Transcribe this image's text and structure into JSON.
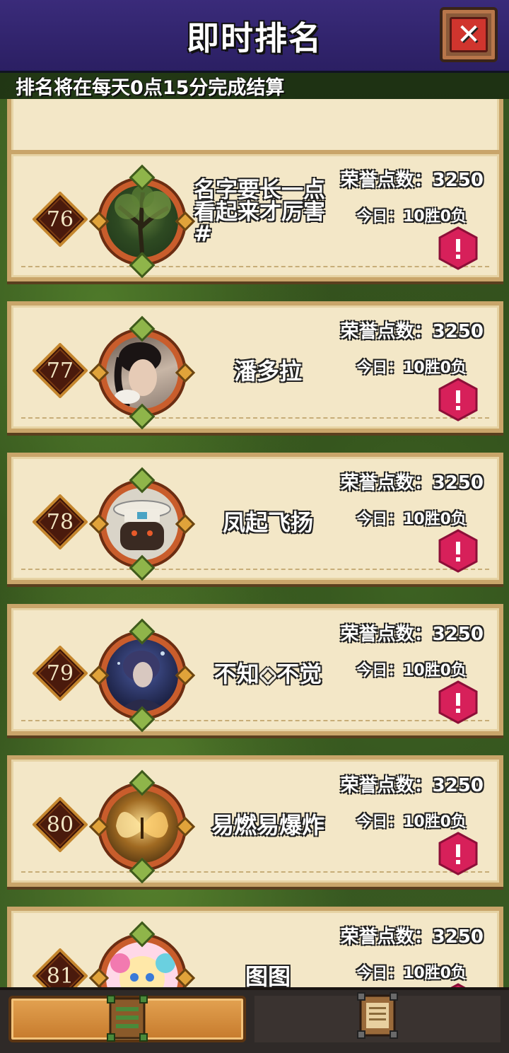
{
  "header": {
    "title": "即时排名",
    "close_icon": "close-icon",
    "notice": "排名将在每天0点15分完成结算"
  },
  "rankings": [
    {
      "rank": "76",
      "name": "名字要长一点看起来才厉害#",
      "honor": "荣誉点数：3250",
      "record": "今日：10胜0负",
      "avatar": "tree",
      "report_icon": "warning-icon"
    },
    {
      "rank": "77",
      "name": "潘多拉",
      "honor": "荣誉点数：3250",
      "record": "今日：10胜0负",
      "avatar": "woman",
      "report_icon": "warning-icon"
    },
    {
      "rank": "78",
      "name": "凤起飞扬",
      "honor": "荣誉点数：3250",
      "record": "今日：10胜0负",
      "avatar": "robot",
      "report_icon": "warning-icon"
    },
    {
      "rank": "79",
      "name": "不知◇不觉",
      "honor": "荣誉点数：3250",
      "record": "今日：10胜0负",
      "avatar": "knight",
      "report_icon": "warning-icon"
    },
    {
      "rank": "80",
      "name": "易燃易爆炸",
      "honor": "荣誉点数：3250",
      "record": "今日：10胜0负",
      "avatar": "butterfly",
      "report_icon": "warning-icon"
    },
    {
      "rank": "81",
      "name": "图图",
      "honor": "荣誉点数：3250",
      "record": "今日：10胜0负",
      "avatar": "cartoon",
      "report_icon": "warning-icon"
    }
  ],
  "bottom_nav": {
    "tabs": [
      {
        "icon": "ranking-list-icon",
        "active": true
      },
      {
        "icon": "scroll-board-icon",
        "active": false
      }
    ]
  },
  "colors": {
    "header_bg": "#2b1f63",
    "card_bg": "#f3e7c7",
    "report_red": "#d7205a",
    "active_tab": "#d88c3c"
  }
}
